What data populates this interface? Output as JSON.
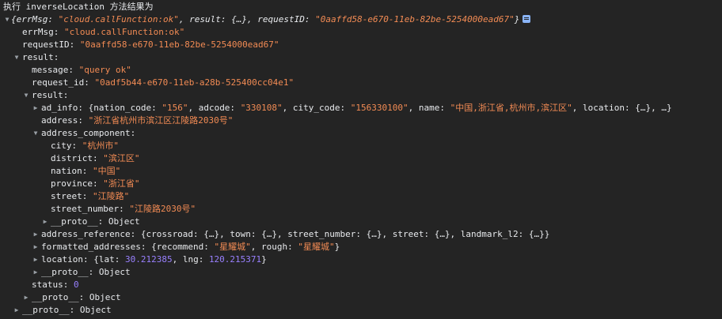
{
  "header": {
    "title": "执行 inverseLocation 方法结果为"
  },
  "summary": {
    "open": "{errMsg: ",
    "errMsg": "\"cloud.callFunction:ok\"",
    "mid1": ", result: {…}, requestID: ",
    "requestID": "\"0aaffd58-e670-11eb-82be-5254000ead67\"",
    "close": "}"
  },
  "errMsg": {
    "key": "errMsg: ",
    "value": "\"cloud.callFunction:ok\""
  },
  "requestID": {
    "key": "requestID: ",
    "value": "\"0aaffd58-e670-11eb-82be-5254000ead67\""
  },
  "result": {
    "key": "result:",
    "message": {
      "key": "message: ",
      "value": "\"query ok\""
    },
    "request_id": {
      "key": "request_id: ",
      "value": "\"0adf5b44-e670-11eb-a28b-525400cc04e1\""
    },
    "inner": {
      "key": "result:",
      "ad_info": {
        "p1": "ad_info: {nation_code: ",
        "nation_code": "\"156\"",
        "p2": ", adcode: ",
        "adcode": "\"330108\"",
        "p3": ", city_code: ",
        "city_code": "\"156330100\"",
        "p4": ", name: ",
        "name": "\"中国,浙江省,杭州市,滨江区\"",
        "p5": ", location: {…}, …}"
      },
      "address": {
        "key": "address: ",
        "value": "\"浙江省杭州市滨江区江陵路2030号\""
      },
      "address_component": {
        "key": "address_component:",
        "city": {
          "key": "city: ",
          "value": "\"杭州市\""
        },
        "district": {
          "key": "district: ",
          "value": "\"滨江区\""
        },
        "nation": {
          "key": "nation: ",
          "value": "\"中国\""
        },
        "province": {
          "key": "province: ",
          "value": "\"浙江省\""
        },
        "street": {
          "key": "street: ",
          "value": "\"江陵路\""
        },
        "street_number": {
          "key": "street_number: ",
          "value": "\"江陵路2030号\""
        },
        "proto": "__proto__: Object"
      },
      "address_reference": "address_reference: {crossroad: {…}, town: {…}, street_number: {…}, street: {…}, landmark_l2: {…}}",
      "formatted_addresses": {
        "p1": "formatted_addresses: {recommend: ",
        "recommend": "\"星耀城\"",
        "p2": ", rough: ",
        "rough": "\"星耀城\"",
        "p3": "}"
      },
      "location": {
        "p1": "location: {lat: ",
        "lat": "30.212385",
        "p2": ", lng: ",
        "lng": "120.215371",
        "p3": "}"
      },
      "proto": "__proto__: Object"
    },
    "status": {
      "key": "status: ",
      "value": "0"
    },
    "proto": "__proto__: Object"
  },
  "root_proto": "__proto__: Object",
  "icons": {
    "expanded": "▼",
    "collapsed": "▶",
    "info": "info-icon"
  }
}
